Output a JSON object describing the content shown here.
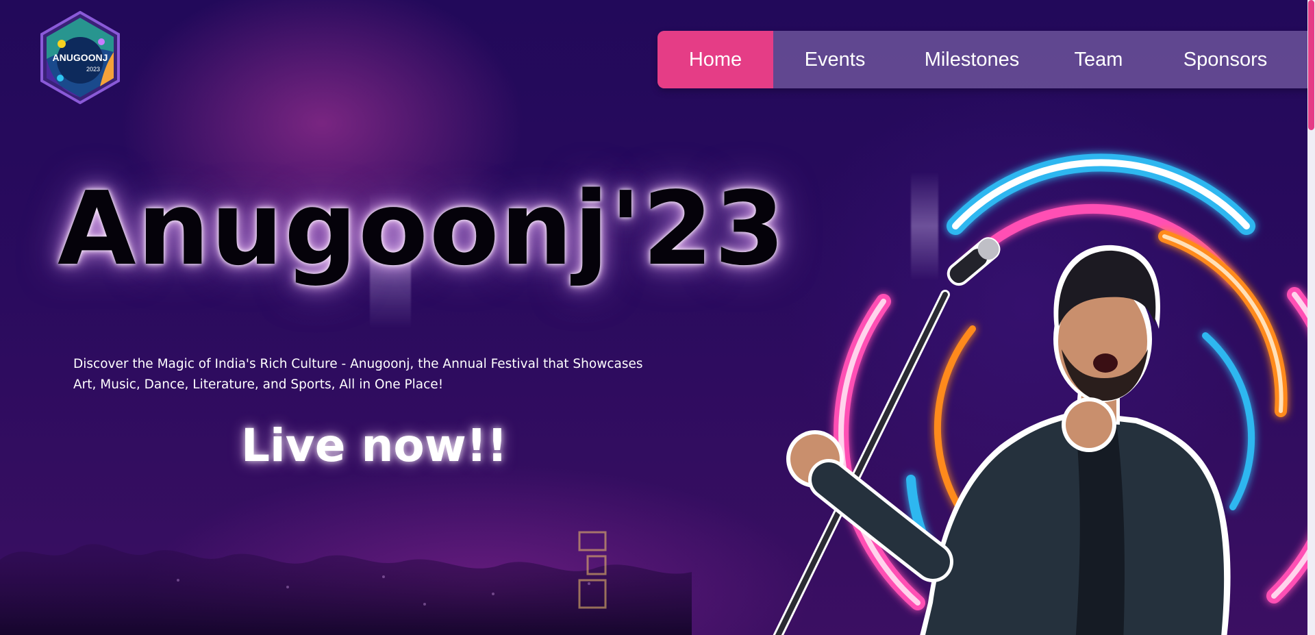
{
  "logo": {
    "text": "ANUGOONJ",
    "year": "2023"
  },
  "nav": {
    "items": [
      {
        "label": "Home",
        "active": true
      },
      {
        "label": "Events",
        "active": false
      },
      {
        "label": "Milestones",
        "active": false
      },
      {
        "label": "Team",
        "active": false
      },
      {
        "label": "Sponsors",
        "active": false
      }
    ]
  },
  "hero": {
    "title": "Anugoonj'23",
    "description": "Discover the Magic of India's Rich Culture - Anugoonj, the Annual Festival that Showcases Art, Music, Dance, Literature, and Sports, All in One Place!",
    "live_label": "Live now!!"
  },
  "colors": {
    "accent": "#e53d86",
    "nav_bg": "#785fa5",
    "background": "#22095a"
  }
}
